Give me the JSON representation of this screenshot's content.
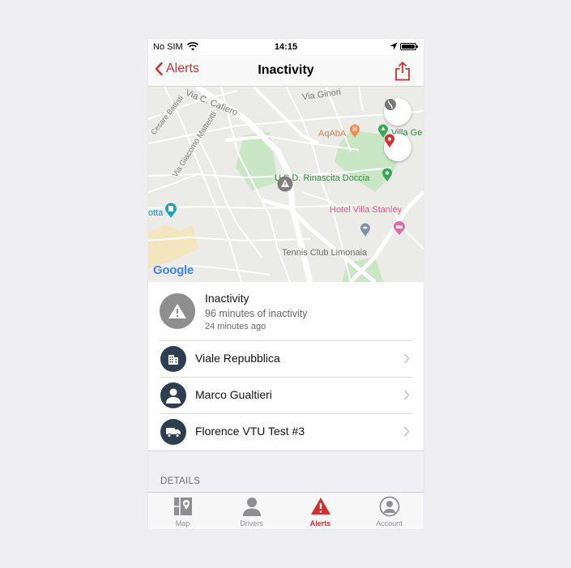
{
  "status_bar": {
    "carrier": "No SIM",
    "time": "14:15"
  },
  "nav": {
    "back_label": "Alerts",
    "title": "Inactivity"
  },
  "map": {
    "labels": {
      "via_ginori": "Via Ginori",
      "via_cafiero": "Via C. Cafiero",
      "via_battisti": "Cesare Battisti",
      "aqaba": "AqAbA",
      "villa_ge": "Villa Ge",
      "rinascita": "U.S.D. Rinascita Doccia",
      "hotel": "Hotel Villa Stanley",
      "via_matteotti": "Via Giacomo Matteotti",
      "otta": "otta",
      "tennis": "Tennis Club Limonaia",
      "google": "Google"
    }
  },
  "alert": {
    "title": "Inactivity",
    "subtitle": "96 minutes of inactivity",
    "time": "24 minutes ago"
  },
  "rows": [
    {
      "label": "Viale Repubblica",
      "icon": "building-icon"
    },
    {
      "label": "Marco Gualtieri",
      "icon": "person-icon"
    },
    {
      "label": "Florence VTU Test #3",
      "icon": "truck-icon"
    }
  ],
  "details_header": "DETAILS",
  "tabs": [
    {
      "label": "Map",
      "icon": "map-icon",
      "active": false
    },
    {
      "label": "Drivers",
      "icon": "driver-icon",
      "active": false
    },
    {
      "label": "Alerts",
      "icon": "alert-icon",
      "active": true
    },
    {
      "label": "Account",
      "icon": "account-icon",
      "active": false
    }
  ],
  "colors": {
    "accent": "#d32f2f",
    "row_icon_bg": "#2d3e50",
    "alert_icon_bg": "#8e8e8e"
  }
}
